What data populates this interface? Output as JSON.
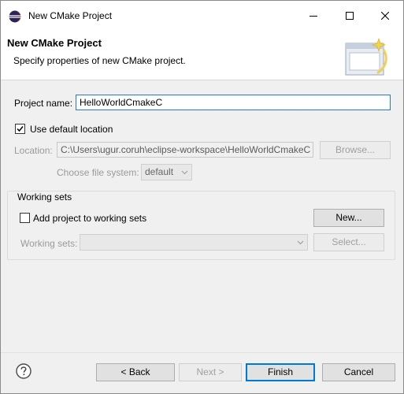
{
  "window": {
    "title": "New CMake Project"
  },
  "banner": {
    "title": "New CMake Project",
    "description": "Specify properties of new CMake project."
  },
  "form": {
    "project_name_label": "Project name:",
    "project_name_value": "HelloWorldCmakeC",
    "use_default_location_label": "Use default location",
    "use_default_location_checked": true,
    "location_label": "Location:",
    "location_value": "C:\\Users\\ugur.coruh\\eclipse-workspace\\HelloWorldCmakeC",
    "browse_label": "Browse...",
    "file_system_label": "Choose file system:",
    "file_system_value": "default"
  },
  "working_sets": {
    "group_label": "Working sets",
    "add_label": "Add project to working sets",
    "add_checked": false,
    "new_label": "New...",
    "sets_label": "Working sets:",
    "sets_value": "",
    "select_label": "Select..."
  },
  "footer": {
    "help_icon": "question-circle-icon",
    "back_label": "< Back",
    "next_label": "Next >",
    "finish_label": "Finish",
    "cancel_label": "Cancel"
  },
  "colors": {
    "focus_border": "#1f7bd6",
    "primary_border": "#0078d7",
    "disabled_text": "#a0a0a0"
  }
}
